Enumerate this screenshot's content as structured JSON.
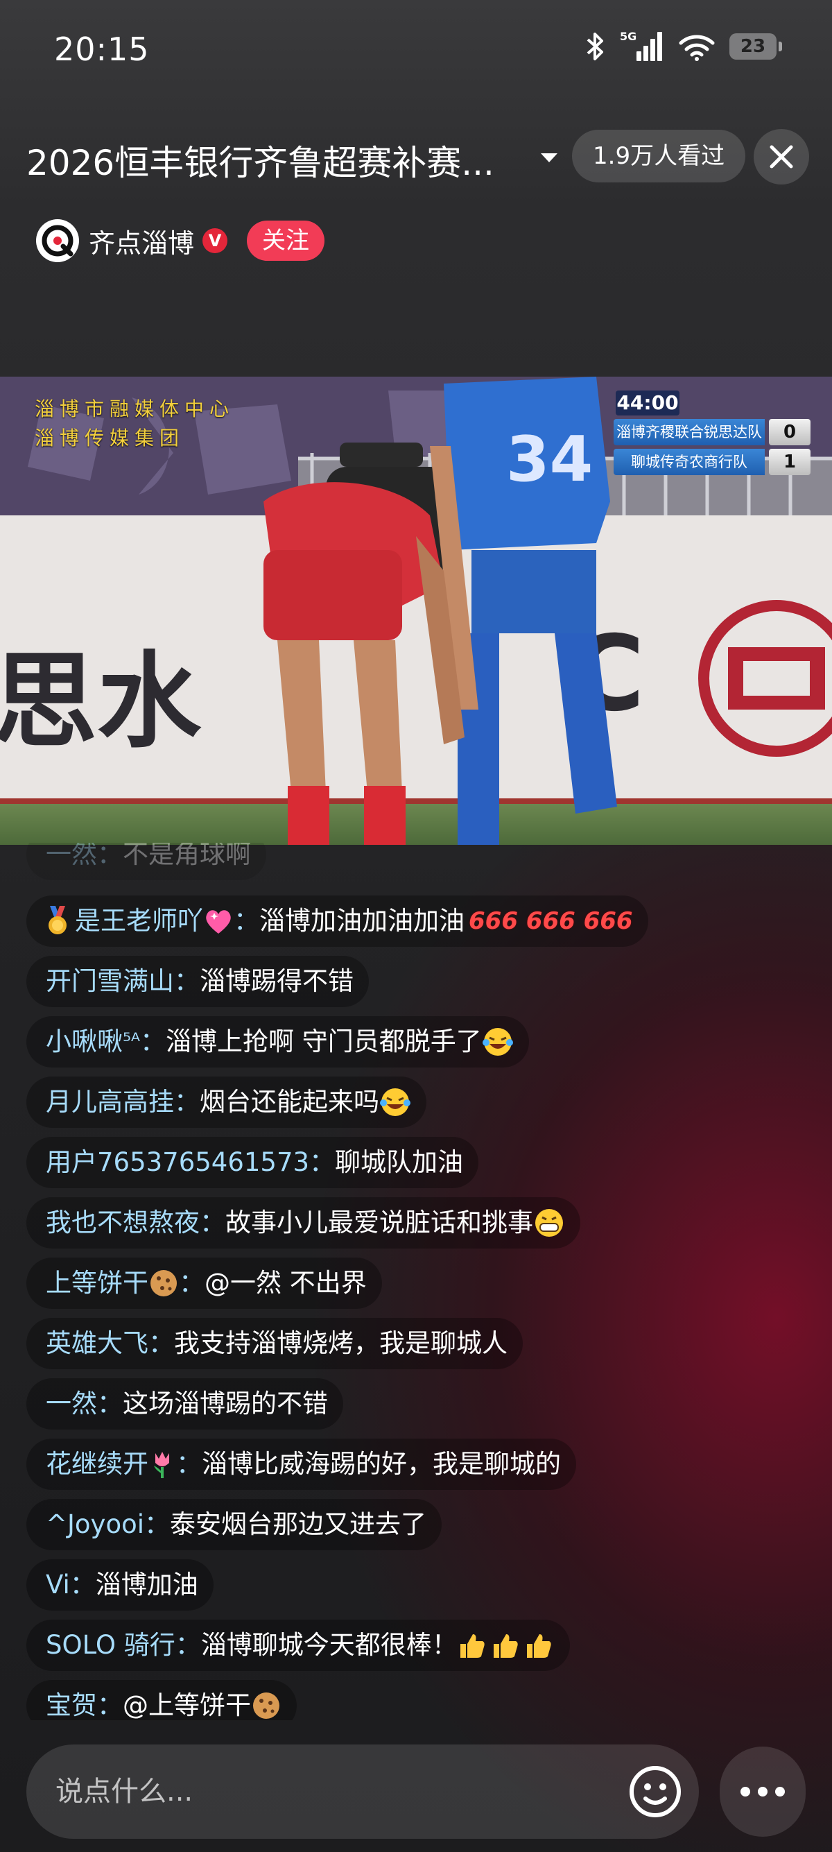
{
  "status_bar": {
    "time": "20:15",
    "battery": "23",
    "network": "5G"
  },
  "header": {
    "title": "2026恒丰银行齐鲁超赛补赛...",
    "views": "1.9万人看过",
    "channel_name": "齐点淄博",
    "verified_badge": "V",
    "follow_label": "关注"
  },
  "video": {
    "watermark_line1": "淄博市融媒体中心",
    "watermark_line2": "淄博传媒集团",
    "clock": "44:00",
    "home_team": "淄博齐稷联合锐思达队",
    "home_score": "0",
    "away_team": "聊城传奇农商行队",
    "away_score": "1",
    "player_number": "34"
  },
  "comments": [
    {
      "user": "一然",
      "message": "不是角球啊"
    },
    {
      "user": "是王老师吖",
      "message": "淄博加油加油加油",
      "extra": "666 666 666"
    },
    {
      "user": "开门雪满山",
      "message": "淄博踢得不错"
    },
    {
      "user": "小啾啾",
      "user_suffix": "⁵ᴬ",
      "message": "淄博上抢啊 守门员都脱手了"
    },
    {
      "user": "月儿高高挂",
      "message": "烟台还能起来吗"
    },
    {
      "user": "用户7653765461573",
      "message": "聊城队加油"
    },
    {
      "user": "我也不想熬夜",
      "message": "故事小儿最爱说脏话和挑事"
    },
    {
      "user": "上等饼干",
      "message": "@一然 不出界"
    },
    {
      "user": "英雄大飞",
      "message": "我支持淄博烧烤，我是聊城人"
    },
    {
      "user": "一然",
      "message": "这场淄博踢的不错"
    },
    {
      "user": "花继续开",
      "message": "淄博比威海踢的好，我是聊城的"
    },
    {
      "user": "^Joyooi",
      "message": "泰安烟台那边又进去了"
    },
    {
      "user": "Vi",
      "message": "淄博加油"
    },
    {
      "user": "SOLO 骑行",
      "message": "淄博聊城今天都很棒！"
    },
    {
      "user": "宝贺",
      "message": "@上等饼干"
    }
  ],
  "input": {
    "placeholder": "说点什么..."
  },
  "colors": {
    "username": "#a7dcfb",
    "follow": "#f23c56",
    "verified": "#e4263a"
  }
}
